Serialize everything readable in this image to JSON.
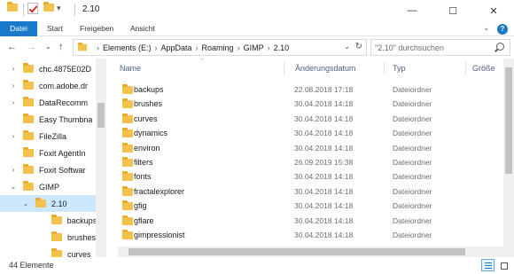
{
  "title_bar": {
    "title": "2.10",
    "qa_dropdown": "▾",
    "minimize": "—",
    "maximize": "☐",
    "close": "✕"
  },
  "ribbon": {
    "tabs": [
      {
        "label": "Datei",
        "active": true
      },
      {
        "label": "Start"
      },
      {
        "label": "Freigeben"
      },
      {
        "label": "Ansicht"
      }
    ],
    "expand": "⌄",
    "help": "?"
  },
  "navigation": {
    "back": "←",
    "forward": "→",
    "recent": "⌄",
    "up": "↑"
  },
  "address": {
    "crumbs": [
      "Elements (E:)",
      "AppData",
      "Roaming",
      "GIMP",
      "2.10"
    ],
    "separator": "›",
    "dropdown": "⌄",
    "refresh": "↻"
  },
  "search": {
    "placeholder": "\"2.10\" durchsuchen"
  },
  "nav_tree": [
    {
      "chevron": "›",
      "label": "chc.4875E02D"
    },
    {
      "chevron": "›",
      "label": "com.adobe.dr"
    },
    {
      "chevron": "›",
      "label": "DataRecomm"
    },
    {
      "chevron": "",
      "label": "Easy Thumbna"
    },
    {
      "chevron": "›",
      "label": "FileZilla"
    },
    {
      "chevron": "",
      "label": "Foxit AgentIn"
    },
    {
      "chevron": "›",
      "label": "Foxit Softwar"
    },
    {
      "chevron": "⌄",
      "label": "GIMP"
    },
    {
      "chevron": "⌄",
      "label": "2.10",
      "selected": true
    },
    {
      "chevron": "",
      "label": "backups"
    },
    {
      "chevron": "",
      "label": "brushes"
    },
    {
      "chevron": "",
      "label": "curves"
    }
  ],
  "columns": {
    "name": "Name",
    "date": "Änderungsdatum",
    "type": "Typ",
    "size": "Größe"
  },
  "files": [
    {
      "name": "backups",
      "date": "22.08.2018 17:18",
      "type": "Dateiordner"
    },
    {
      "name": "brushes",
      "date": "30.04.2018 14:18",
      "type": "Dateiordner"
    },
    {
      "name": "curves",
      "date": "30.04.2018 14:18",
      "type": "Dateiordner"
    },
    {
      "name": "dynamics",
      "date": "30.04.2018 14:18",
      "type": "Dateiordner"
    },
    {
      "name": "environ",
      "date": "30.04.2018 14:18",
      "type": "Dateiordner"
    },
    {
      "name": "filters",
      "date": "26.09.2019 15:38",
      "type": "Dateiordner"
    },
    {
      "name": "fonts",
      "date": "30.04.2018 14:18",
      "type": "Dateiordner"
    },
    {
      "name": "fractalexplorer",
      "date": "30.04.2018 14:18",
      "type": "Dateiordner"
    },
    {
      "name": "gfig",
      "date": "30.04.2018 14:18",
      "type": "Dateiordner"
    },
    {
      "name": "gflare",
      "date": "30.04.2018 14:18",
      "type": "Dateiordner"
    },
    {
      "name": "gimpressionist",
      "date": "30.04.2018 14:18",
      "type": "Dateiordner"
    }
  ],
  "status": {
    "item_count": "44 Elemente"
  },
  "colors": {
    "accent": "#1979ca",
    "selection": "#cce8ff",
    "folder": "#f2c14e",
    "header_text": "#4d6082"
  }
}
